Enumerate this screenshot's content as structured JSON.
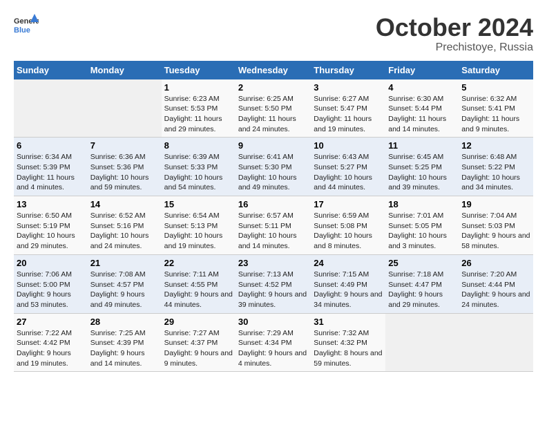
{
  "header": {
    "logo_general": "General",
    "logo_blue": "Blue",
    "month_title": "October 2024",
    "location": "Prechistoye, Russia"
  },
  "weekdays": [
    "Sunday",
    "Monday",
    "Tuesday",
    "Wednesday",
    "Thursday",
    "Friday",
    "Saturday"
  ],
  "weeks": [
    [
      null,
      null,
      {
        "day": "1",
        "sunrise": "Sunrise: 6:23 AM",
        "sunset": "Sunset: 5:53 PM",
        "daylight": "Daylight: 11 hours and 29 minutes."
      },
      {
        "day": "2",
        "sunrise": "Sunrise: 6:25 AM",
        "sunset": "Sunset: 5:50 PM",
        "daylight": "Daylight: 11 hours and 24 minutes."
      },
      {
        "day": "3",
        "sunrise": "Sunrise: 6:27 AM",
        "sunset": "Sunset: 5:47 PM",
        "daylight": "Daylight: 11 hours and 19 minutes."
      },
      {
        "day": "4",
        "sunrise": "Sunrise: 6:30 AM",
        "sunset": "Sunset: 5:44 PM",
        "daylight": "Daylight: 11 hours and 14 minutes."
      },
      {
        "day": "5",
        "sunrise": "Sunrise: 6:32 AM",
        "sunset": "Sunset: 5:41 PM",
        "daylight": "Daylight: 11 hours and 9 minutes."
      }
    ],
    [
      {
        "day": "6",
        "sunrise": "Sunrise: 6:34 AM",
        "sunset": "Sunset: 5:39 PM",
        "daylight": "Daylight: 11 hours and 4 minutes."
      },
      {
        "day": "7",
        "sunrise": "Sunrise: 6:36 AM",
        "sunset": "Sunset: 5:36 PM",
        "daylight": "Daylight: 10 hours and 59 minutes."
      },
      {
        "day": "8",
        "sunrise": "Sunrise: 6:39 AM",
        "sunset": "Sunset: 5:33 PM",
        "daylight": "Daylight: 10 hours and 54 minutes."
      },
      {
        "day": "9",
        "sunrise": "Sunrise: 6:41 AM",
        "sunset": "Sunset: 5:30 PM",
        "daylight": "Daylight: 10 hours and 49 minutes."
      },
      {
        "day": "10",
        "sunrise": "Sunrise: 6:43 AM",
        "sunset": "Sunset: 5:27 PM",
        "daylight": "Daylight: 10 hours and 44 minutes."
      },
      {
        "day": "11",
        "sunrise": "Sunrise: 6:45 AM",
        "sunset": "Sunset: 5:25 PM",
        "daylight": "Daylight: 10 hours and 39 minutes."
      },
      {
        "day": "12",
        "sunrise": "Sunrise: 6:48 AM",
        "sunset": "Sunset: 5:22 PM",
        "daylight": "Daylight: 10 hours and 34 minutes."
      }
    ],
    [
      {
        "day": "13",
        "sunrise": "Sunrise: 6:50 AM",
        "sunset": "Sunset: 5:19 PM",
        "daylight": "Daylight: 10 hours and 29 minutes."
      },
      {
        "day": "14",
        "sunrise": "Sunrise: 6:52 AM",
        "sunset": "Sunset: 5:16 PM",
        "daylight": "Daylight: 10 hours and 24 minutes."
      },
      {
        "day": "15",
        "sunrise": "Sunrise: 6:54 AM",
        "sunset": "Sunset: 5:13 PM",
        "daylight": "Daylight: 10 hours and 19 minutes."
      },
      {
        "day": "16",
        "sunrise": "Sunrise: 6:57 AM",
        "sunset": "Sunset: 5:11 PM",
        "daylight": "Daylight: 10 hours and 14 minutes."
      },
      {
        "day": "17",
        "sunrise": "Sunrise: 6:59 AM",
        "sunset": "Sunset: 5:08 PM",
        "daylight": "Daylight: 10 hours and 8 minutes."
      },
      {
        "day": "18",
        "sunrise": "Sunrise: 7:01 AM",
        "sunset": "Sunset: 5:05 PM",
        "daylight": "Daylight: 10 hours and 3 minutes."
      },
      {
        "day": "19",
        "sunrise": "Sunrise: 7:04 AM",
        "sunset": "Sunset: 5:03 PM",
        "daylight": "Daylight: 9 hours and 58 minutes."
      }
    ],
    [
      {
        "day": "20",
        "sunrise": "Sunrise: 7:06 AM",
        "sunset": "Sunset: 5:00 PM",
        "daylight": "Daylight: 9 hours and 53 minutes."
      },
      {
        "day": "21",
        "sunrise": "Sunrise: 7:08 AM",
        "sunset": "Sunset: 4:57 PM",
        "daylight": "Daylight: 9 hours and 49 minutes."
      },
      {
        "day": "22",
        "sunrise": "Sunrise: 7:11 AM",
        "sunset": "Sunset: 4:55 PM",
        "daylight": "Daylight: 9 hours and 44 minutes."
      },
      {
        "day": "23",
        "sunrise": "Sunrise: 7:13 AM",
        "sunset": "Sunset: 4:52 PM",
        "daylight": "Daylight: 9 hours and 39 minutes."
      },
      {
        "day": "24",
        "sunrise": "Sunrise: 7:15 AM",
        "sunset": "Sunset: 4:49 PM",
        "daylight": "Daylight: 9 hours and 34 minutes."
      },
      {
        "day": "25",
        "sunrise": "Sunrise: 7:18 AM",
        "sunset": "Sunset: 4:47 PM",
        "daylight": "Daylight: 9 hours and 29 minutes."
      },
      {
        "day": "26",
        "sunrise": "Sunrise: 7:20 AM",
        "sunset": "Sunset: 4:44 PM",
        "daylight": "Daylight: 9 hours and 24 minutes."
      }
    ],
    [
      {
        "day": "27",
        "sunrise": "Sunrise: 7:22 AM",
        "sunset": "Sunset: 4:42 PM",
        "daylight": "Daylight: 9 hours and 19 minutes."
      },
      {
        "day": "28",
        "sunrise": "Sunrise: 7:25 AM",
        "sunset": "Sunset: 4:39 PM",
        "daylight": "Daylight: 9 hours and 14 minutes."
      },
      {
        "day": "29",
        "sunrise": "Sunrise: 7:27 AM",
        "sunset": "Sunset: 4:37 PM",
        "daylight": "Daylight: 9 hours and 9 minutes."
      },
      {
        "day": "30",
        "sunrise": "Sunrise: 7:29 AM",
        "sunset": "Sunset: 4:34 PM",
        "daylight": "Daylight: 9 hours and 4 minutes."
      },
      {
        "day": "31",
        "sunrise": "Sunrise: 7:32 AM",
        "sunset": "Sunset: 4:32 PM",
        "daylight": "Daylight: 8 hours and 59 minutes."
      },
      null,
      null
    ]
  ]
}
